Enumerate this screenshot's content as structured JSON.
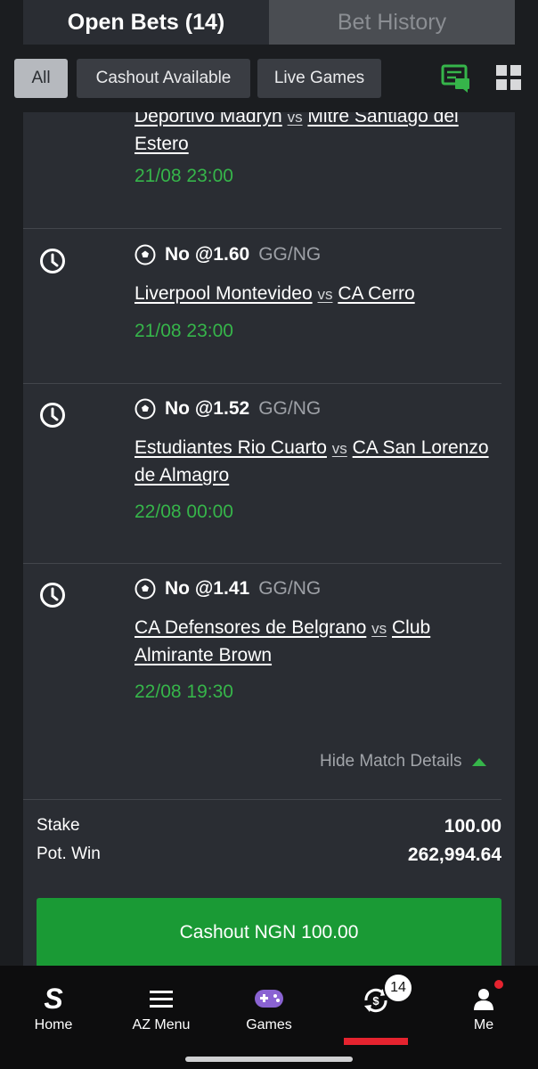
{
  "tabs": {
    "open_bets": "Open Bets (14)",
    "bet_history": "Bet History"
  },
  "filters": {
    "all": "All",
    "cashout_available": "Cashout Available",
    "live_games": "Live Games"
  },
  "bets": [
    {
      "home": "Deportivo Madryn",
      "vs": "vs",
      "away": "Mitre Santiago del Estero",
      "date": "21/08 23:00"
    },
    {
      "pick": "No @1.60",
      "market": "GG/NG",
      "home": "Liverpool Montevideo",
      "vs": "vs",
      "away": "CA Cerro",
      "date": "21/08 23:00"
    },
    {
      "pick": "No @1.52",
      "market": "GG/NG",
      "home": "Estudiantes Rio Cuarto",
      "vs": "vs",
      "away": "CA San Lorenzo de Almagro",
      "date": "22/08 00:00"
    },
    {
      "pick": "No @1.41",
      "market": "GG/NG",
      "home": "CA Defensores de Belgrano",
      "vs": "vs",
      "away": "Club Almirante Brown",
      "date": "22/08 19:30"
    }
  ],
  "details_toggle": "Hide Match Details",
  "summary": {
    "stake_label": "Stake",
    "stake_value": "100.00",
    "potwin_label": "Pot. Win",
    "potwin_value": "262,994.64"
  },
  "cashout_button": "Cashout NGN 100.00",
  "bottom_nav": {
    "home": "Home",
    "az_menu": "AZ Menu",
    "games": "Games",
    "me": "Me",
    "badge_count": "14"
  },
  "colors": {
    "accent_green": "#36b54a",
    "cashout_green": "#1a9a35",
    "active_red": "#e5232f"
  }
}
